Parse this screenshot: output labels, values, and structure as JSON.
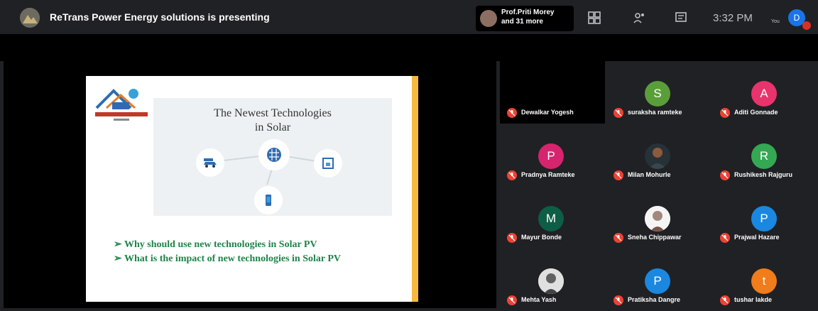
{
  "header": {
    "presenting_text": "ReTrans Power Energy solutions is presenting",
    "participants_name": "Prof.Priti Morey",
    "participants_more": "and 31 more",
    "clock": "3:32 PM",
    "you_label": "You",
    "self_initial": "D",
    "icons": [
      "layout-icon",
      "people-icon",
      "chat-icon"
    ]
  },
  "slide": {
    "title_line1": "The Newest Technologies",
    "title_line2": "in Solar",
    "bullets": [
      "➢ Why should use new technologies in Solar PV",
      "➢ What is the impact of new technologies in Solar PV"
    ],
    "accent_color": "#f6b93b",
    "bullet_color": "#1e8449"
  },
  "participants": [
    {
      "name": "Dewalkar Yogesh",
      "initial": "",
      "color": "#000000",
      "type": "blank"
    },
    {
      "name": "suraksha ramteke",
      "initial": "S",
      "color": "#5a9e3a",
      "type": "letter"
    },
    {
      "name": "Aditi Gonnade",
      "initial": "A",
      "color": "#e8336d",
      "type": "letter"
    },
    {
      "name": "Pradnya Ramteke",
      "initial": "P",
      "color": "#d6246e",
      "type": "letter"
    },
    {
      "name": "Milan Mohurle",
      "initial": "",
      "color": "#202124",
      "type": "photo"
    },
    {
      "name": "Rushikesh Rajguru",
      "initial": "R",
      "color": "#34a853",
      "type": "letter"
    },
    {
      "name": "Mayur Bonde",
      "initial": "M",
      "color": "#0d5e45",
      "type": "letter"
    },
    {
      "name": "Sneha Chippawar",
      "initial": "",
      "color": "#e0e0e0",
      "type": "photo"
    },
    {
      "name": "Prajwal Hazare",
      "initial": "P",
      "color": "#1a88e0",
      "type": "letter"
    },
    {
      "name": "Mehta Yash",
      "initial": "",
      "color": "#e0e0e0",
      "type": "photo"
    },
    {
      "name": "Pratiksha Dangre",
      "initial": "P",
      "color": "#1a88e0",
      "type": "letter"
    },
    {
      "name": "tushar lakde",
      "initial": "t",
      "color": "#f07c1b",
      "type": "letter"
    }
  ],
  "muted_color": "#ea4335"
}
